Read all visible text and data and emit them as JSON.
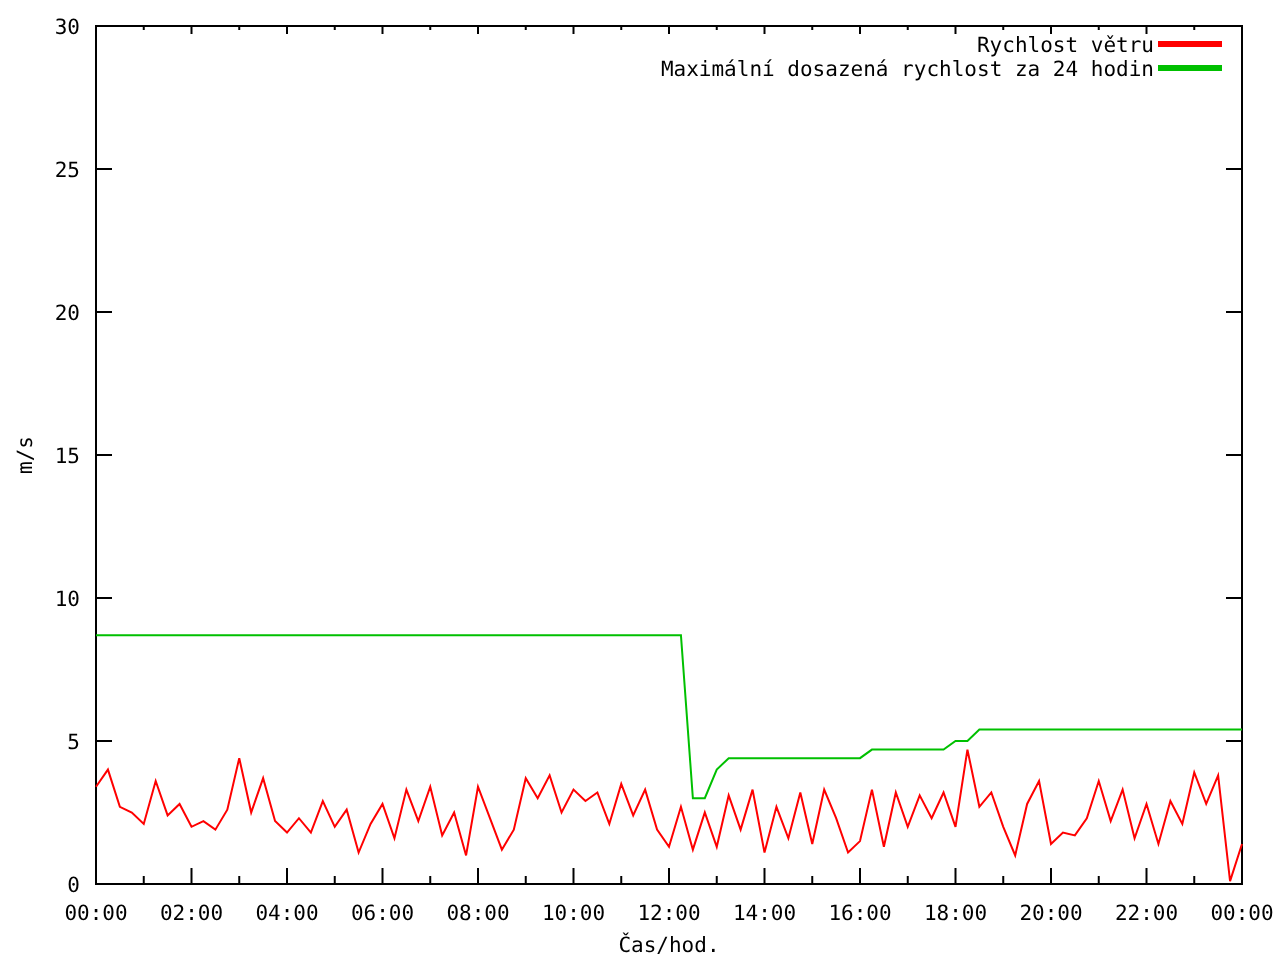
{
  "chart_data": {
    "type": "line",
    "legend": "top-right",
    "xlabel": "Čas/hod.",
    "ylabel": "m/s",
    "xlim": [
      0,
      24
    ],
    "ylim": [
      0,
      30
    ],
    "yticks": [
      0,
      5,
      10,
      15,
      20,
      25,
      30
    ],
    "xticks": [
      {
        "value": 0,
        "label": "00:00"
      },
      {
        "value": 2,
        "label": "02:00"
      },
      {
        "value": 4,
        "label": "04:00"
      },
      {
        "value": 6,
        "label": "06:00"
      },
      {
        "value": 8,
        "label": "08:00"
      },
      {
        "value": 10,
        "label": "10:00"
      },
      {
        "value": 12,
        "label": "12:00"
      },
      {
        "value": 14,
        "label": "14:00"
      },
      {
        "value": 16,
        "label": "16:00"
      },
      {
        "value": 18,
        "label": "18:00"
      },
      {
        "value": 20,
        "label": "20:00"
      },
      {
        "value": 22,
        "label": "22:00"
      },
      {
        "value": 24,
        "label": "00:00"
      }
    ],
    "x": [
      0,
      0.25,
      0.5,
      0.75,
      1,
      1.25,
      1.5,
      1.75,
      2,
      2.25,
      2.5,
      2.75,
      3,
      3.25,
      3.5,
      3.75,
      4,
      4.25,
      4.5,
      4.75,
      5,
      5.25,
      5.5,
      5.75,
      6,
      6.25,
      6.5,
      6.75,
      7,
      7.25,
      7.5,
      7.75,
      8,
      8.25,
      8.5,
      8.75,
      9,
      9.25,
      9.5,
      9.75,
      10,
      10.25,
      10.5,
      10.75,
      11,
      11.25,
      11.5,
      11.75,
      12,
      12.25,
      12.5,
      12.75,
      13,
      13.25,
      13.5,
      13.75,
      14,
      14.25,
      14.5,
      14.75,
      15,
      15.25,
      15.5,
      15.75,
      16,
      16.25,
      16.5,
      16.75,
      17,
      17.25,
      17.5,
      17.75,
      18,
      18.25,
      18.5,
      18.75,
      19,
      19.25,
      19.5,
      19.75,
      20,
      20.25,
      20.5,
      20.75,
      21,
      21.25,
      21.5,
      21.75,
      22,
      22.25,
      22.5,
      22.75,
      23,
      23.25,
      23.5,
      23.75,
      24
    ],
    "series": [
      {
        "name": "Rychlost větru",
        "color": "#ff0000",
        "values": [
          3.4,
          4.0,
          2.7,
          2.5,
          2.1,
          3.6,
          2.4,
          2.8,
          2.0,
          2.2,
          1.9,
          2.6,
          4.4,
          2.5,
          3.7,
          2.2,
          1.8,
          2.3,
          1.8,
          2.9,
          2.0,
          2.6,
          1.1,
          2.1,
          2.8,
          1.6,
          3.3,
          2.2,
          3.4,
          1.7,
          2.5,
          1.0,
          3.4,
          2.3,
          1.2,
          1.9,
          3.7,
          3.0,
          3.8,
          2.5,
          3.3,
          2.9,
          3.2,
          2.1,
          3.5,
          2.4,
          3.3,
          1.9,
          1.3,
          2.7,
          1.2,
          2.5,
          1.3,
          3.1,
          1.9,
          3.3,
          1.1,
          2.7,
          1.6,
          3.2,
          1.4,
          3.3,
          2.3,
          1.1,
          1.5,
          3.3,
          1.3,
          3.2,
          2.0,
          3.1,
          2.3,
          3.2,
          2.0,
          4.7,
          2.7,
          3.2,
          2.0,
          1.0,
          2.8,
          3.6,
          1.4,
          1.8,
          1.7,
          2.3,
          3.6,
          2.2,
          3.3,
          1.6,
          2.8,
          1.4,
          2.9,
          2.1,
          3.9,
          2.8,
          3.8,
          0.1,
          1.4
        ]
      },
      {
        "name": "Maximální dosazená rychlost za 24 hodin",
        "color": "#00c000",
        "values": [
          8.7,
          8.7,
          8.7,
          8.7,
          8.7,
          8.7,
          8.7,
          8.7,
          8.7,
          8.7,
          8.7,
          8.7,
          8.7,
          8.7,
          8.7,
          8.7,
          8.7,
          8.7,
          8.7,
          8.7,
          8.7,
          8.7,
          8.7,
          8.7,
          8.7,
          8.7,
          8.7,
          8.7,
          8.7,
          8.7,
          8.7,
          8.7,
          8.7,
          8.7,
          8.7,
          8.7,
          8.7,
          8.7,
          8.7,
          8.7,
          8.7,
          8.7,
          8.7,
          8.7,
          8.7,
          8.7,
          8.7,
          8.7,
          8.7,
          8.7,
          3.0,
          3.0,
          4.0,
          4.4,
          4.4,
          4.4,
          4.4,
          4.4,
          4.4,
          4.4,
          4.4,
          4.4,
          4.4,
          4.4,
          4.4,
          4.7,
          4.7,
          4.7,
          4.7,
          4.7,
          4.7,
          4.7,
          5.0,
          5.0,
          5.4,
          5.4,
          5.4,
          5.4,
          5.4,
          5.4,
          5.4,
          5.4,
          5.4,
          5.4,
          5.4,
          5.4,
          5.4,
          5.4,
          5.4,
          5.4,
          5.4,
          5.4,
          5.4,
          5.4,
          5.4,
          5.4,
          5.4
        ]
      }
    ]
  }
}
